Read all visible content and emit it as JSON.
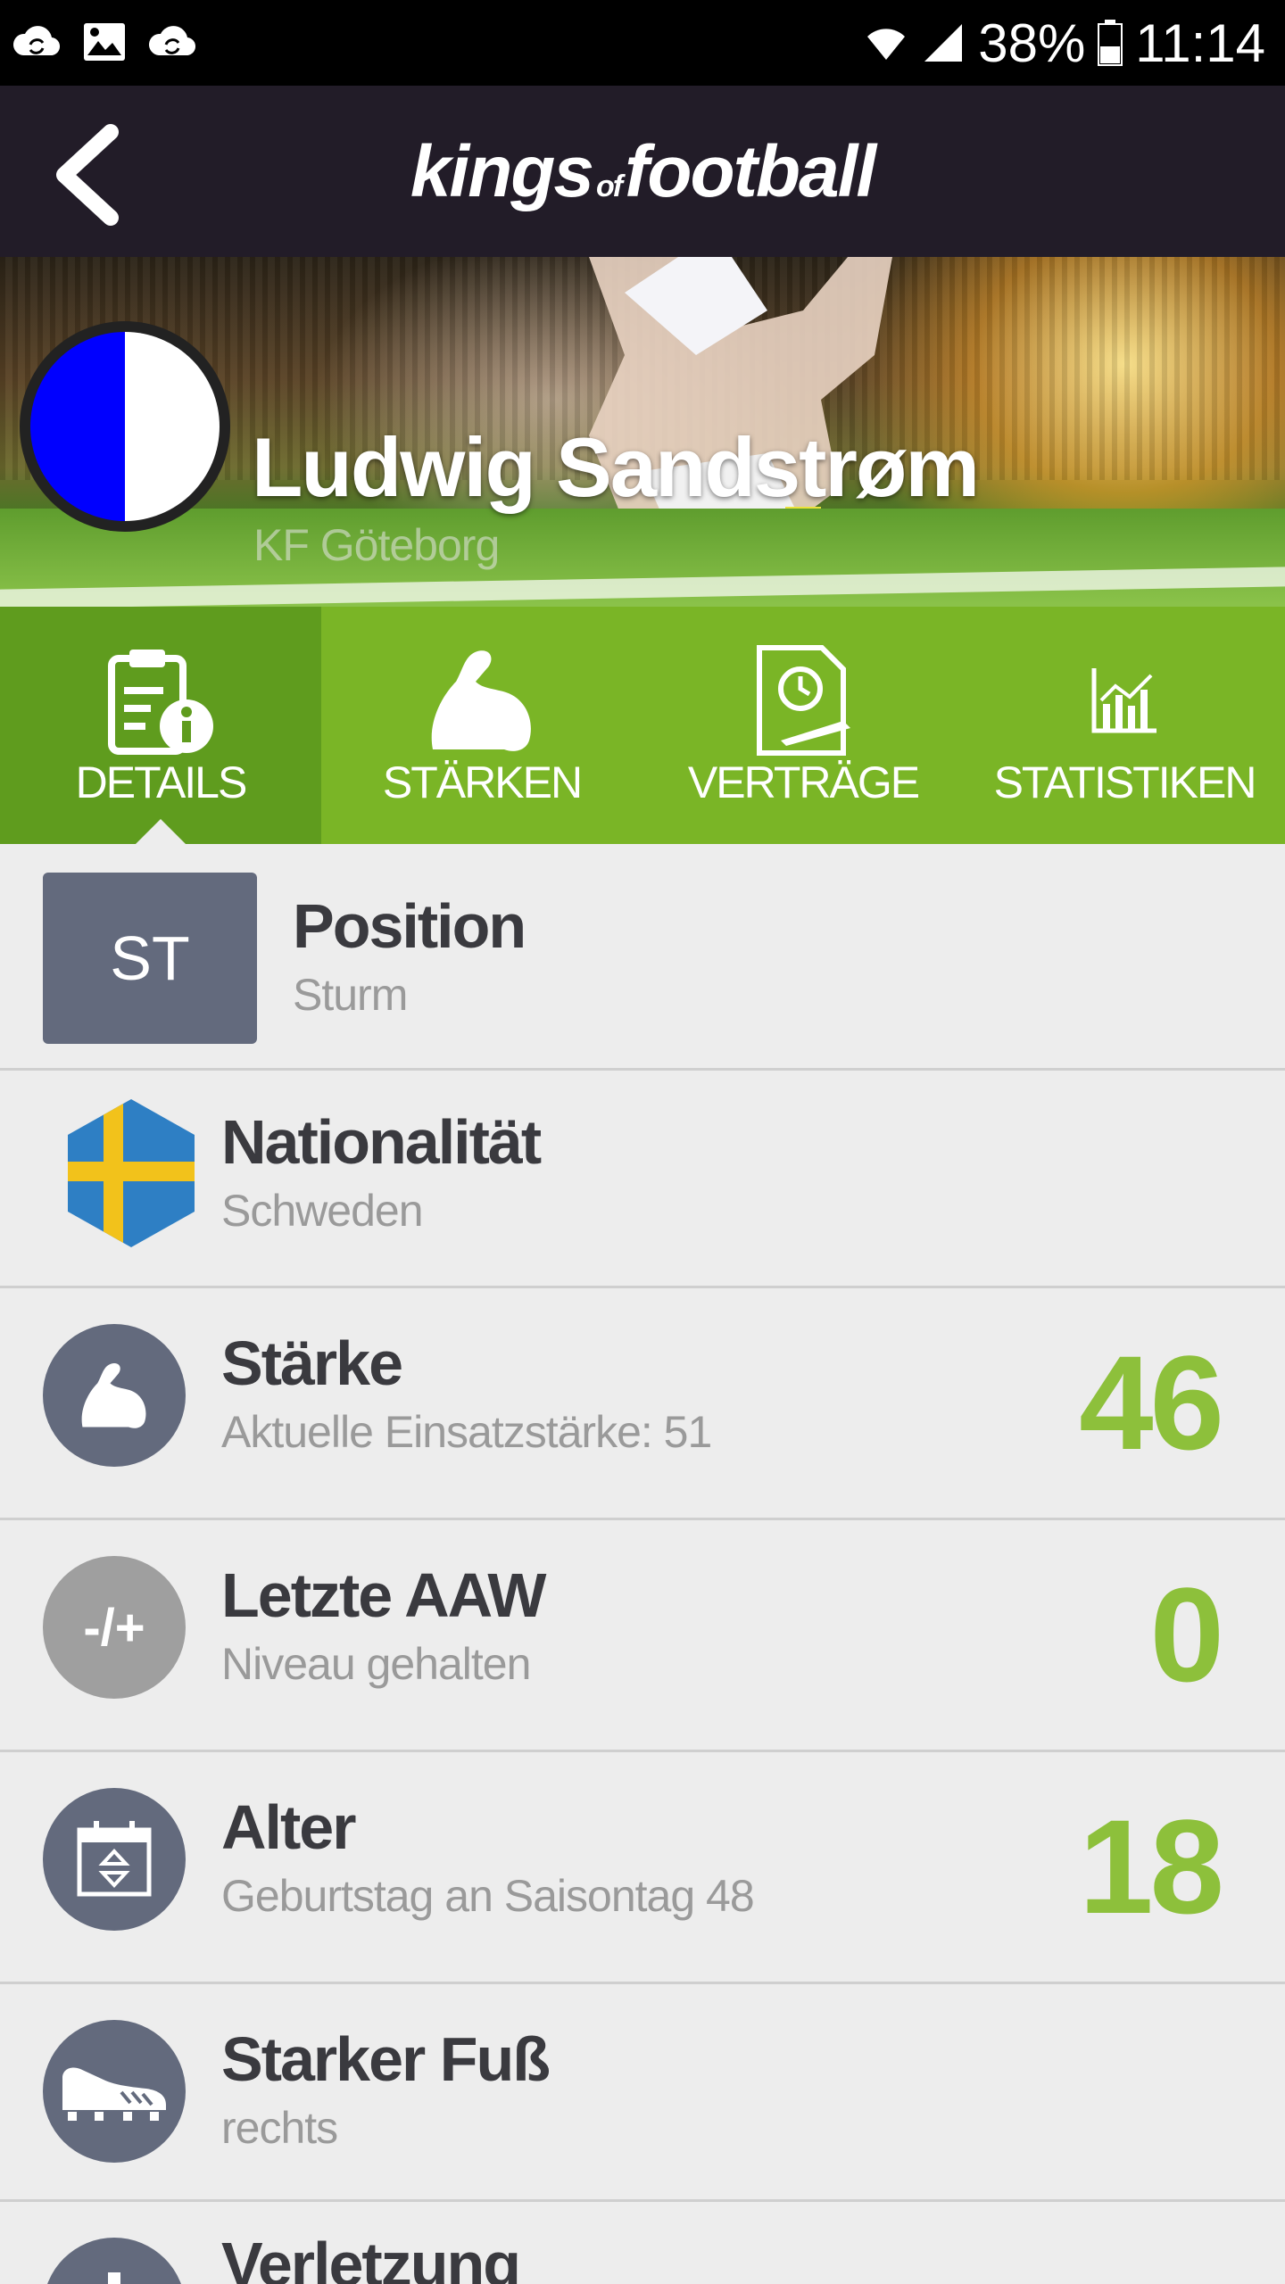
{
  "status_bar": {
    "battery": "38%",
    "time": "11:14",
    "icons": [
      "sync-cloud-icon",
      "image-icon",
      "sync-cloud-icon",
      "wifi-icon",
      "signal-icon",
      "battery-icon"
    ]
  },
  "app_bar": {
    "brand_part1": "kings",
    "brand_of": "of",
    "brand_part2": "football"
  },
  "player": {
    "name": "Ludwig Sandstrøm",
    "club": "KF Göteborg",
    "club_colors": [
      "#0000ff",
      "#ffffff"
    ]
  },
  "tabs": [
    {
      "label": "DETAILS",
      "icon": "details-document-icon",
      "active": true
    },
    {
      "label": "STÄRKEN",
      "icon": "flexed-arm-icon",
      "active": false
    },
    {
      "label": "VERTRÄGE",
      "icon": "contract-icon",
      "active": false
    },
    {
      "label": "STATISTIKEN",
      "icon": "chart-icon",
      "active": false
    }
  ],
  "details": {
    "position": {
      "badge": "ST",
      "title": "Position",
      "sub": "Sturm"
    },
    "nationality": {
      "title": "Nationalität",
      "sub": "Schweden",
      "flag": "sweden-flag-icon"
    },
    "strength": {
      "title": "Stärke",
      "sub": "Aktuelle Einsatzstärke: 51",
      "value": "46",
      "icon": "flexed-arm-icon"
    },
    "last_aaw": {
      "title": "Letzte AAW",
      "sub": "Niveau gehalten",
      "value": "0",
      "icon_text": "-/+"
    },
    "age": {
      "title": "Alter",
      "sub": "Geburtstag an Saisontag 48",
      "value": "18",
      "icon": "calendar-icon"
    },
    "foot": {
      "title": "Starker Fuß",
      "sub": "rechts",
      "icon": "football-boot-icon"
    },
    "injury": {
      "title": "Verletzung"
    }
  },
  "colors": {
    "tab_bar": "#7ab526",
    "tab_active": "#5f9c1e",
    "value_green": "#8dc03b",
    "icon_circle": "#636a7d"
  }
}
